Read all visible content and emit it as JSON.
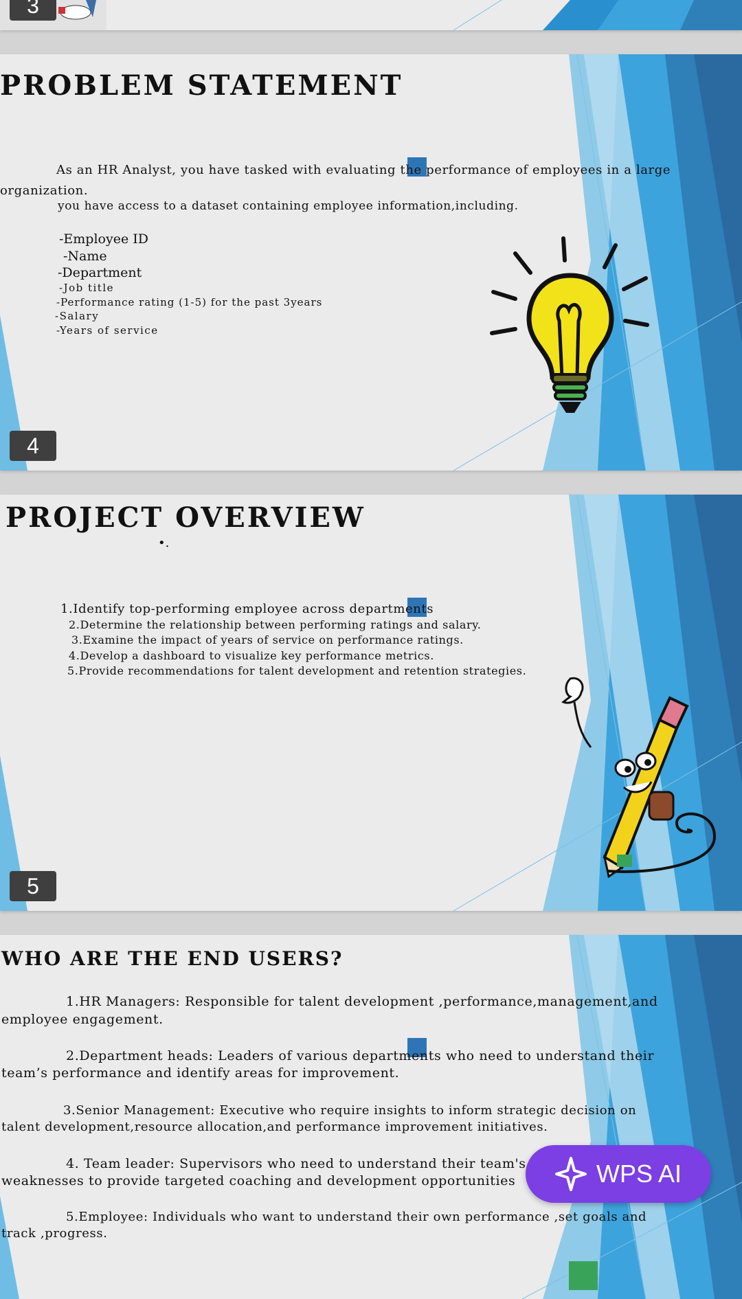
{
  "slides": [
    {
      "number": "3"
    },
    {
      "number": "4",
      "title": "PROBLEM STATEMENT",
      "lines": [
        "As an HR Analyst, you have tasked with evaluating the performance of employees in a large",
        "organization.",
        "you have access to a dataset containing employee information,including.",
        "-Employee ID",
        "-Name",
        "-Department",
        "-Job title",
        "-Performance rating (1-5) for the past 3years",
        "-Salary",
        "-Years of service"
      ]
    },
    {
      "number": "5",
      "title": "PROJECT OVERVIEW",
      "bullet": "•.",
      "lines": [
        "1.Identify top-performing employee across departments",
        "2.Determine the relationship between performing ratings and salary.",
        "3.Examine the impact of years of service on performance ratings.",
        "4.Develop a dashboard to visualize key performance metrics.",
        "5.Provide recommendations for talent development and retention strategies."
      ]
    },
    {
      "title": "WHO ARE THE END USERS?",
      "lines": [
        "1.HR Managers: Responsible for talent development ,performance,management,and",
        "employee engagement.",
        "2.Department heads: Leaders of various departments who need to understand their",
        "team’s performance and identify areas for improvement.",
        "3.Senior Management: Executive who require insights to inform strategic decision on",
        "talent development,resource allocation,and performance improvement initiatives.",
        "4. Team leader: Supervisors who need to understand their team's strengths and",
        "weaknesses to provide targeted coaching and development opportunities",
        "5.Employee: Individuals who want to understand their own performance ,set goals and",
        "track ,progress."
      ]
    }
  ],
  "wps_ai": {
    "label": "WPS AI",
    "icon": "sparkle-icon",
    "color": "#7b3fe4"
  },
  "colors": {
    "accent_blue": "#2e75b6",
    "slide_bg": "#ebebeb",
    "badge": "#3f3f3f"
  }
}
